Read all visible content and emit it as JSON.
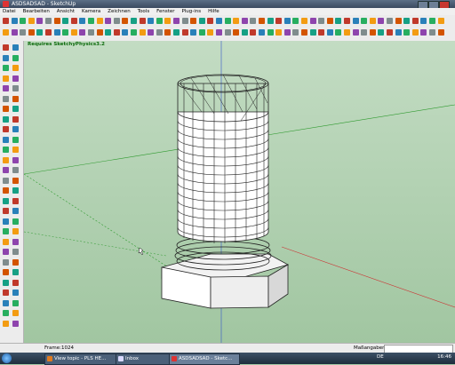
{
  "window": {
    "title": "ASDSADSAD - SketchUp"
  },
  "menubar": {
    "items": [
      "Datei",
      "Bearbeiten",
      "Ansicht",
      "Kamera",
      "Zeichnen",
      "Tools",
      "Fenster",
      "Plug-ins",
      "Hilfe"
    ]
  },
  "viewport": {
    "note": "Requires SketchyPhysics3.2"
  },
  "statusbar": {
    "frame": "Frame:1024",
    "measurements_label": "Maßangaben"
  },
  "taskbar": {
    "items": [
      {
        "label": "View topic - PLS HE...",
        "icon": "firefox-icon"
      },
      {
        "label": "Inbox",
        "icon": "mail-icon"
      },
      {
        "label": "ASDSADSAD - Sketc...",
        "icon": "sketchup-icon",
        "active": true
      }
    ],
    "lang": "DE",
    "clock": "16:46"
  }
}
